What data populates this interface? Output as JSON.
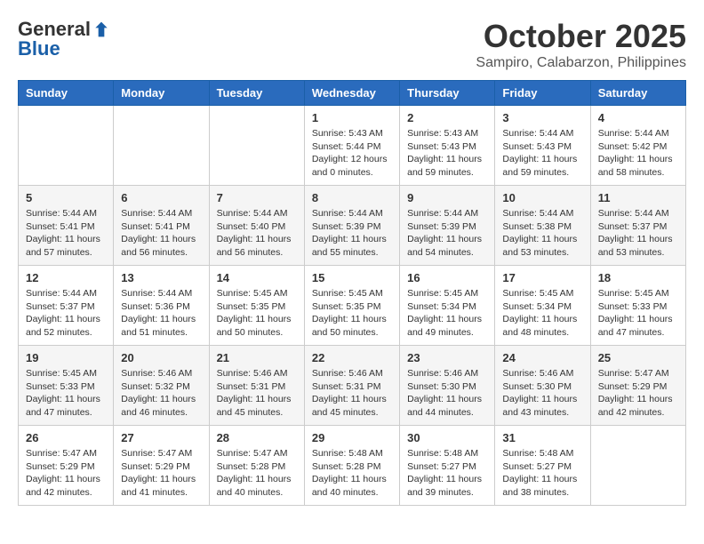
{
  "logo": {
    "general": "General",
    "blue": "Blue"
  },
  "title": "October 2025",
  "location": "Sampiro, Calabarzon, Philippines",
  "weekdays": [
    "Sunday",
    "Monday",
    "Tuesday",
    "Wednesday",
    "Thursday",
    "Friday",
    "Saturday"
  ],
  "weeks": [
    [
      {
        "day": "",
        "info": ""
      },
      {
        "day": "",
        "info": ""
      },
      {
        "day": "",
        "info": ""
      },
      {
        "day": "1",
        "info": "Sunrise: 5:43 AM\nSunset: 5:44 PM\nDaylight: 12 hours\nand 0 minutes."
      },
      {
        "day": "2",
        "info": "Sunrise: 5:43 AM\nSunset: 5:43 PM\nDaylight: 11 hours\nand 59 minutes."
      },
      {
        "day": "3",
        "info": "Sunrise: 5:44 AM\nSunset: 5:43 PM\nDaylight: 11 hours\nand 59 minutes."
      },
      {
        "day": "4",
        "info": "Sunrise: 5:44 AM\nSunset: 5:42 PM\nDaylight: 11 hours\nand 58 minutes."
      }
    ],
    [
      {
        "day": "5",
        "info": "Sunrise: 5:44 AM\nSunset: 5:41 PM\nDaylight: 11 hours\nand 57 minutes."
      },
      {
        "day": "6",
        "info": "Sunrise: 5:44 AM\nSunset: 5:41 PM\nDaylight: 11 hours\nand 56 minutes."
      },
      {
        "day": "7",
        "info": "Sunrise: 5:44 AM\nSunset: 5:40 PM\nDaylight: 11 hours\nand 56 minutes."
      },
      {
        "day": "8",
        "info": "Sunrise: 5:44 AM\nSunset: 5:39 PM\nDaylight: 11 hours\nand 55 minutes."
      },
      {
        "day": "9",
        "info": "Sunrise: 5:44 AM\nSunset: 5:39 PM\nDaylight: 11 hours\nand 54 minutes."
      },
      {
        "day": "10",
        "info": "Sunrise: 5:44 AM\nSunset: 5:38 PM\nDaylight: 11 hours\nand 53 minutes."
      },
      {
        "day": "11",
        "info": "Sunrise: 5:44 AM\nSunset: 5:37 PM\nDaylight: 11 hours\nand 53 minutes."
      }
    ],
    [
      {
        "day": "12",
        "info": "Sunrise: 5:44 AM\nSunset: 5:37 PM\nDaylight: 11 hours\nand 52 minutes."
      },
      {
        "day": "13",
        "info": "Sunrise: 5:44 AM\nSunset: 5:36 PM\nDaylight: 11 hours\nand 51 minutes."
      },
      {
        "day": "14",
        "info": "Sunrise: 5:45 AM\nSunset: 5:35 PM\nDaylight: 11 hours\nand 50 minutes."
      },
      {
        "day": "15",
        "info": "Sunrise: 5:45 AM\nSunset: 5:35 PM\nDaylight: 11 hours\nand 50 minutes."
      },
      {
        "day": "16",
        "info": "Sunrise: 5:45 AM\nSunset: 5:34 PM\nDaylight: 11 hours\nand 49 minutes."
      },
      {
        "day": "17",
        "info": "Sunrise: 5:45 AM\nSunset: 5:34 PM\nDaylight: 11 hours\nand 48 minutes."
      },
      {
        "day": "18",
        "info": "Sunrise: 5:45 AM\nSunset: 5:33 PM\nDaylight: 11 hours\nand 47 minutes."
      }
    ],
    [
      {
        "day": "19",
        "info": "Sunrise: 5:45 AM\nSunset: 5:33 PM\nDaylight: 11 hours\nand 47 minutes."
      },
      {
        "day": "20",
        "info": "Sunrise: 5:46 AM\nSunset: 5:32 PM\nDaylight: 11 hours\nand 46 minutes."
      },
      {
        "day": "21",
        "info": "Sunrise: 5:46 AM\nSunset: 5:31 PM\nDaylight: 11 hours\nand 45 minutes."
      },
      {
        "day": "22",
        "info": "Sunrise: 5:46 AM\nSunset: 5:31 PM\nDaylight: 11 hours\nand 45 minutes."
      },
      {
        "day": "23",
        "info": "Sunrise: 5:46 AM\nSunset: 5:30 PM\nDaylight: 11 hours\nand 44 minutes."
      },
      {
        "day": "24",
        "info": "Sunrise: 5:46 AM\nSunset: 5:30 PM\nDaylight: 11 hours\nand 43 minutes."
      },
      {
        "day": "25",
        "info": "Sunrise: 5:47 AM\nSunset: 5:29 PM\nDaylight: 11 hours\nand 42 minutes."
      }
    ],
    [
      {
        "day": "26",
        "info": "Sunrise: 5:47 AM\nSunset: 5:29 PM\nDaylight: 11 hours\nand 42 minutes."
      },
      {
        "day": "27",
        "info": "Sunrise: 5:47 AM\nSunset: 5:29 PM\nDaylight: 11 hours\nand 41 minutes."
      },
      {
        "day": "28",
        "info": "Sunrise: 5:47 AM\nSunset: 5:28 PM\nDaylight: 11 hours\nand 40 minutes."
      },
      {
        "day": "29",
        "info": "Sunrise: 5:48 AM\nSunset: 5:28 PM\nDaylight: 11 hours\nand 40 minutes."
      },
      {
        "day": "30",
        "info": "Sunrise: 5:48 AM\nSunset: 5:27 PM\nDaylight: 11 hours\nand 39 minutes."
      },
      {
        "day": "31",
        "info": "Sunrise: 5:48 AM\nSunset: 5:27 PM\nDaylight: 11 hours\nand 38 minutes."
      },
      {
        "day": "",
        "info": ""
      }
    ]
  ]
}
